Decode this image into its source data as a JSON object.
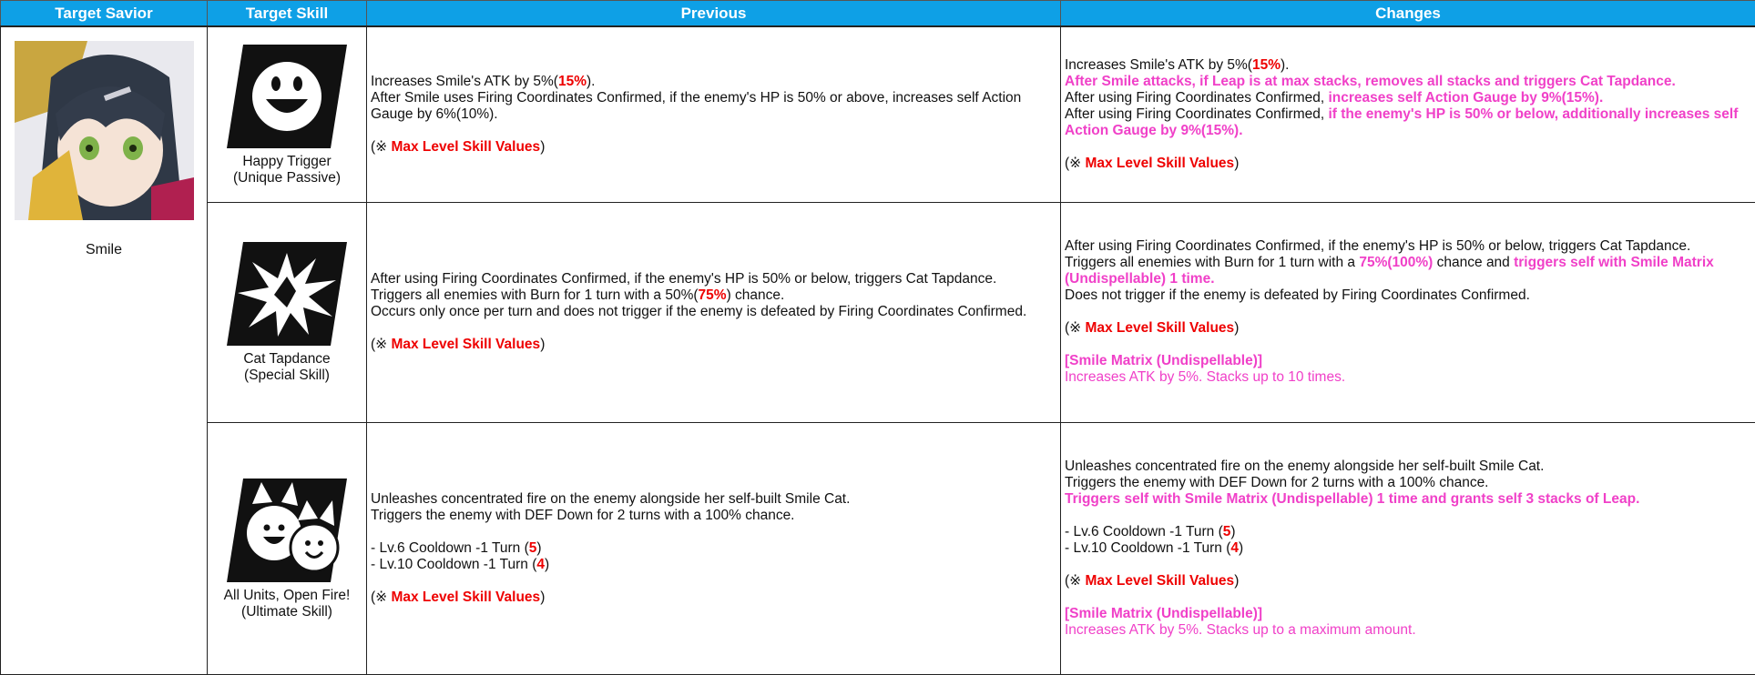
{
  "headers": [
    "Target Savior",
    "Target Skill",
    "Previous",
    "Changes"
  ],
  "savior": {
    "name": "Smile"
  },
  "note": {
    "prefix": "(※ ",
    "label": "Max Level Skill Values",
    "suffix": ")"
  },
  "skills": [
    {
      "name": "Happy Trigger",
      "type": "(Unique Passive)",
      "icon": "smiley-face-icon",
      "previous": {
        "l1a": "Increases Smile's ATK by 5%(",
        "l1v": "15%",
        "l1b": ").",
        "l2": "After Smile uses Firing Coordinates Confirmed, if the enemy's HP is 50% or above, increases self Action Gauge by 6%(10%)."
      },
      "changes": {
        "l1a": "Increases Smile's ATK by 5%(",
        "l1v": "15%",
        "l1b": ").",
        "l2": "After Smile attacks, if Leap is at max stacks, removes all stacks and triggers Cat Tapdance.",
        "l3a": "After using Firing Coordinates Confirmed, ",
        "l3b": "increases self Action Gauge by 9%(15%).",
        "l4a": "After using Firing Coordinates Confirmed, ",
        "l4b": "if the enemy's HP is 50% or below, additionally increases self Action Gauge by 9%(15%)."
      }
    },
    {
      "name": "Cat Tapdance",
      "type": "(Special Skill)",
      "icon": "burst-icon",
      "previous": {
        "l1": "After using Firing Coordinates Confirmed, if the enemy's HP is 50% or below, triggers Cat Tapdance.",
        "l2a": "Triggers all enemies with Burn for 1 turn with a 50%(",
        "l2v": "75%",
        "l2b": ") chance.",
        "l3": "Occurs only once per turn and does not trigger if the enemy is defeated by Firing Coordinates Confirmed."
      },
      "changes": {
        "l1": "After using Firing Coordinates Confirmed, if the enemy's HP is 50% or below, triggers Cat Tapdance.",
        "l2a": "Triggers all enemies with Burn for 1 turn with a ",
        "l2v": "75%(100%)",
        "l2b": " chance and ",
        "l2c": "triggers self with Smile Matrix (Undispellable) 1 time.",
        "l3": "Does not trigger if the enemy is defeated by Firing Coordinates Confirmed.",
        "buff_name": "[Smile Matrix (Undispellable)]",
        "buff_desc": "Increases ATK by 5%. Stacks up to 10  times."
      }
    },
    {
      "name": "All Units, Open Fire!",
      "type": "(Ultimate Skill)",
      "icon": "cats-icon",
      "previous": {
        "l1": "Unleashes concentrated fire on the enemy alongside her self-built Smile Cat.",
        "l2": "Triggers the enemy with DEF Down for 2 turns with a 100% chance.",
        "cd1a": "- Lv.6 Cooldown -1 Turn (",
        "cd1v": "5",
        "cd1b": ")",
        "cd2a": "- Lv.10 Cooldown -1 Turn (",
        "cd2v": "4",
        "cd2b": ")"
      },
      "changes": {
        "l1": "Unleashes concentrated fire on the enemy alongside her self-built Smile Cat.",
        "l2": "Triggers the enemy with DEF Down for 2 turns with a 100% chance.",
        "l3": "Triggers self with Smile Matrix (Undispellable) 1 time and grants self 3 stacks of Leap.",
        "cd1a": "- Lv.6 Cooldown -1 Turn (",
        "cd1v": "5",
        "cd1b": ")",
        "cd2a": "- Lv.10 Cooldown -1 Turn (",
        "cd2v": "4",
        "cd2b": ")",
        "buff_name": "[Smile Matrix (Undispellable)]",
        "buff_desc": "Increases ATK by 5%. Stacks up to a maximum amount."
      }
    }
  ],
  "colors": {
    "header_bg": "#0ea0e6",
    "value_red": "#e00000",
    "change_pink": "#f040c8"
  }
}
